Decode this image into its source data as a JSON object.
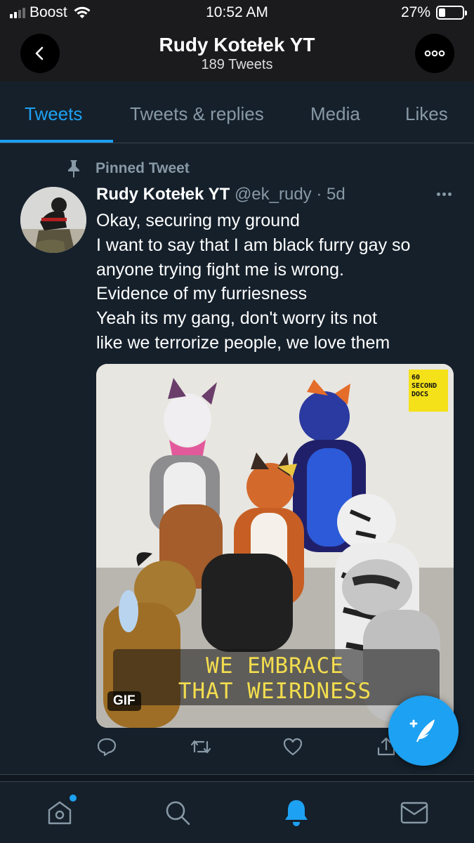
{
  "status_bar": {
    "carrier": "Boost",
    "time": "10:52 AM",
    "battery": "27%",
    "battery_level": 0.27
  },
  "header": {
    "title": "Rudy Kotełek YT",
    "subtitle": "189 Tweets"
  },
  "tabs": [
    {
      "label": "Tweets",
      "active": true
    },
    {
      "label": "Tweets & replies",
      "active": false
    },
    {
      "label": "Media",
      "active": false
    },
    {
      "label": "Likes",
      "active": false
    }
  ],
  "tweet": {
    "pinned_label": "Pinned Tweet",
    "author_name": "Rudy Kotełek YT",
    "handle": "@ek_rudy",
    "separator": "·",
    "time": "5d",
    "text_lines": [
      "Okay, securing my ground",
      "I want to say that I am black furry gay so",
      "anyone trying fight me is wrong.",
      "Evidence of my furriesness",
      "Yeah its my gang, don't worry its not",
      "like we terrorize people, we love them"
    ],
    "media": {
      "badge_lines": [
        "60",
        "SECOND",
        "DOCS"
      ],
      "caption_lines": [
        "WE EMBRACE",
        "THAT WEIRDNESS"
      ],
      "gif_label": "GIF"
    }
  },
  "colors": {
    "accent": "#1da1f2",
    "background": "#15202b",
    "muted": "#8899a6"
  },
  "icons": {
    "back": "chevron-left-icon",
    "more": "ellipsis-icon",
    "pin": "pin-icon",
    "reply": "reply-icon",
    "retweet": "retweet-icon",
    "like": "heart-icon",
    "share": "share-icon",
    "compose": "compose-tweet-icon",
    "home": "home-icon",
    "search": "search-icon",
    "notifications": "bell-icon",
    "messages": "mail-icon"
  }
}
